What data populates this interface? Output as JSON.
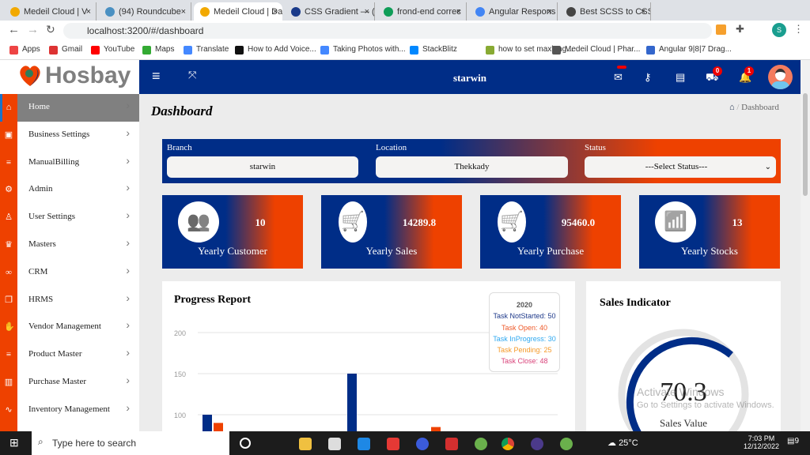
{
  "browser": {
    "tabs": [
      {
        "label": "Medeil Cloud | V",
        "color": "#f2a900"
      },
      {
        "label": "(94) Roundcube",
        "color": "#4a90c2"
      },
      {
        "label": "Medeil Cloud | Da",
        "color": "#f2a900",
        "active": true
      },
      {
        "label": "CSS Gradient — (",
        "color": "#1a3a8a"
      },
      {
        "label": "frond-end correc",
        "color": "#0f9d58"
      },
      {
        "label": "Angular Respons",
        "color": "#4285f4"
      },
      {
        "label": "Best SCSS to CSS",
        "color": "#444"
      }
    ],
    "url": "localhost:3200/#/dashboard",
    "bookmarks": [
      "Apps",
      "Gmail",
      "YouTube",
      "Maps",
      "Translate",
      "How to Add Voice...",
      "Taking Photos with...",
      "StackBlitz",
      "how to set maxleng...",
      "Medeil Cloud | Phar...",
      "Angular 9|8|7 Drag..."
    ],
    "profile_initial": "S"
  },
  "logo": {
    "text": "Hosbay"
  },
  "header": {
    "title": "starwin",
    "cart_count": "0",
    "notification_count": "1"
  },
  "sidebar": {
    "items": [
      {
        "label": "Home",
        "icon": "home-icon",
        "glyph": "⌂"
      },
      {
        "label": "Business Settings",
        "icon": "save-icon",
        "glyph": "▣"
      },
      {
        "label": "ManualBilling",
        "icon": "database-icon",
        "glyph": "≡"
      },
      {
        "label": "Admin",
        "icon": "gear-icon",
        "glyph": "⚙"
      },
      {
        "label": "User Settings",
        "icon": "user-icon",
        "glyph": "♙"
      },
      {
        "label": "Masters",
        "icon": "crown-icon",
        "glyph": "♛"
      },
      {
        "label": "CRM",
        "icon": "link-icon",
        "glyph": "∞"
      },
      {
        "label": "HRMS",
        "icon": "copy-icon",
        "glyph": "❐"
      },
      {
        "label": "Vendor Management",
        "icon": "hand-icon",
        "glyph": "✋"
      },
      {
        "label": "Product Master",
        "icon": "database-icon",
        "glyph": "≡"
      },
      {
        "label": "Purchase Master",
        "icon": "building-icon",
        "glyph": "▥"
      },
      {
        "label": "Inventory Management",
        "icon": "heartbeat-icon",
        "glyph": "∿"
      }
    ]
  },
  "page": {
    "title": "Dashboard",
    "breadcrumb": "Dashboard"
  },
  "filters": {
    "branch_label": "Branch",
    "branch_value": "starwin",
    "location_label": "Location",
    "location_value": "Thekkady",
    "status_label": "Status",
    "status_value": "---Select Status---"
  },
  "cards": [
    {
      "value": "10",
      "label": "Yearly Customer",
      "icon": "users-icon",
      "glyph": "👥"
    },
    {
      "value": "14289.8",
      "label": "Yearly Sales",
      "icon": "cart-icon",
      "glyph": "🛒"
    },
    {
      "value": "95460.0",
      "label": "Yearly Purchase",
      "icon": "cart-icon",
      "glyph": "🛒"
    },
    {
      "value": "13",
      "label": "Yearly Stocks",
      "icon": "bar-chart-icon",
      "glyph": "📶"
    }
  ],
  "progress": {
    "title": "Progress Report"
  },
  "chart_data": {
    "type": "bar",
    "title": "Progress Report",
    "ylim": [
      0,
      200
    ],
    "yticks": [
      100,
      150,
      200
    ],
    "grid": true,
    "colors": {
      "blue": "#002d87",
      "orange": "#ee4100"
    },
    "visible_bars": [
      {
        "group": 1,
        "color": "blue",
        "value": 100
      },
      {
        "group": 1,
        "color": "orange",
        "value": 90
      },
      {
        "group": 2,
        "color": "blue",
        "value": 150
      },
      {
        "group": 3,
        "color": "orange",
        "value": 85
      }
    ],
    "tooltip": {
      "title": "2020",
      "rows": [
        {
          "label": "Task NotStarted: 50",
          "color": "#1f3a8a"
        },
        {
          "label": "Task Open: 40",
          "color": "#ee5a2a"
        },
        {
          "label": "Task InProgress: 30",
          "color": "#2ea8f0"
        },
        {
          "label": "Task Pending: 25",
          "color": "#f59a2a"
        },
        {
          "label": "Task Close: 48",
          "color": "#d9437a"
        }
      ]
    }
  },
  "sales": {
    "title": "Sales Indicator",
    "value": "70.3",
    "label": "Sales Value",
    "percent": 70.3
  },
  "watermark": {
    "line1": "Activate Windows",
    "line2": "Go to Settings to activate Windows."
  },
  "taskbar": {
    "search_placeholder": "Type here to search",
    "weather": "25°C",
    "time": "7:03 PM",
    "date": "12/12/2022",
    "notif": "9"
  }
}
